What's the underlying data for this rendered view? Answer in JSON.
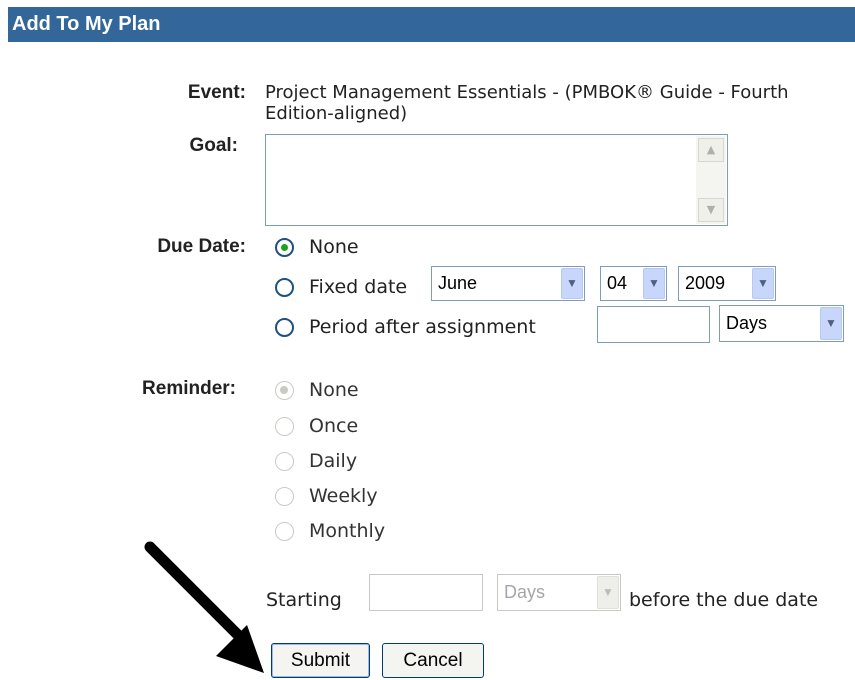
{
  "title": "Add To My Plan",
  "event": {
    "label": "Event:",
    "value": "Project Management Essentials - (PMBOK® Guide - Fourth Edition-aligned)"
  },
  "goal": {
    "label": "Goal:",
    "value": ""
  },
  "due_date": {
    "label": "Due Date:",
    "options": {
      "none": "None",
      "fixed": "Fixed date",
      "period": "Period after assignment"
    },
    "selected": "none",
    "fixed_month": "June",
    "fixed_day": "04",
    "fixed_year": "2009",
    "period_value": "",
    "period_unit": "Days"
  },
  "reminder": {
    "label": "Reminder:",
    "options": [
      "None",
      "Once",
      "Daily",
      "Weekly",
      "Monthly"
    ],
    "selected": "None",
    "starting_label": "Starting",
    "starting_value": "",
    "starting_unit": "Days",
    "suffix": "before the due date"
  },
  "buttons": {
    "submit": "Submit",
    "cancel": "Cancel"
  },
  "icons": {
    "scroll_up": "chevron-up-icon",
    "scroll_down": "chevron-down-icon",
    "dropdown": "chevron-down-icon",
    "annotation": "arrow-icon"
  },
  "colors": {
    "titlebar": "#336699",
    "radio_selected": "#21a121",
    "input_border": "#7f9db9"
  }
}
